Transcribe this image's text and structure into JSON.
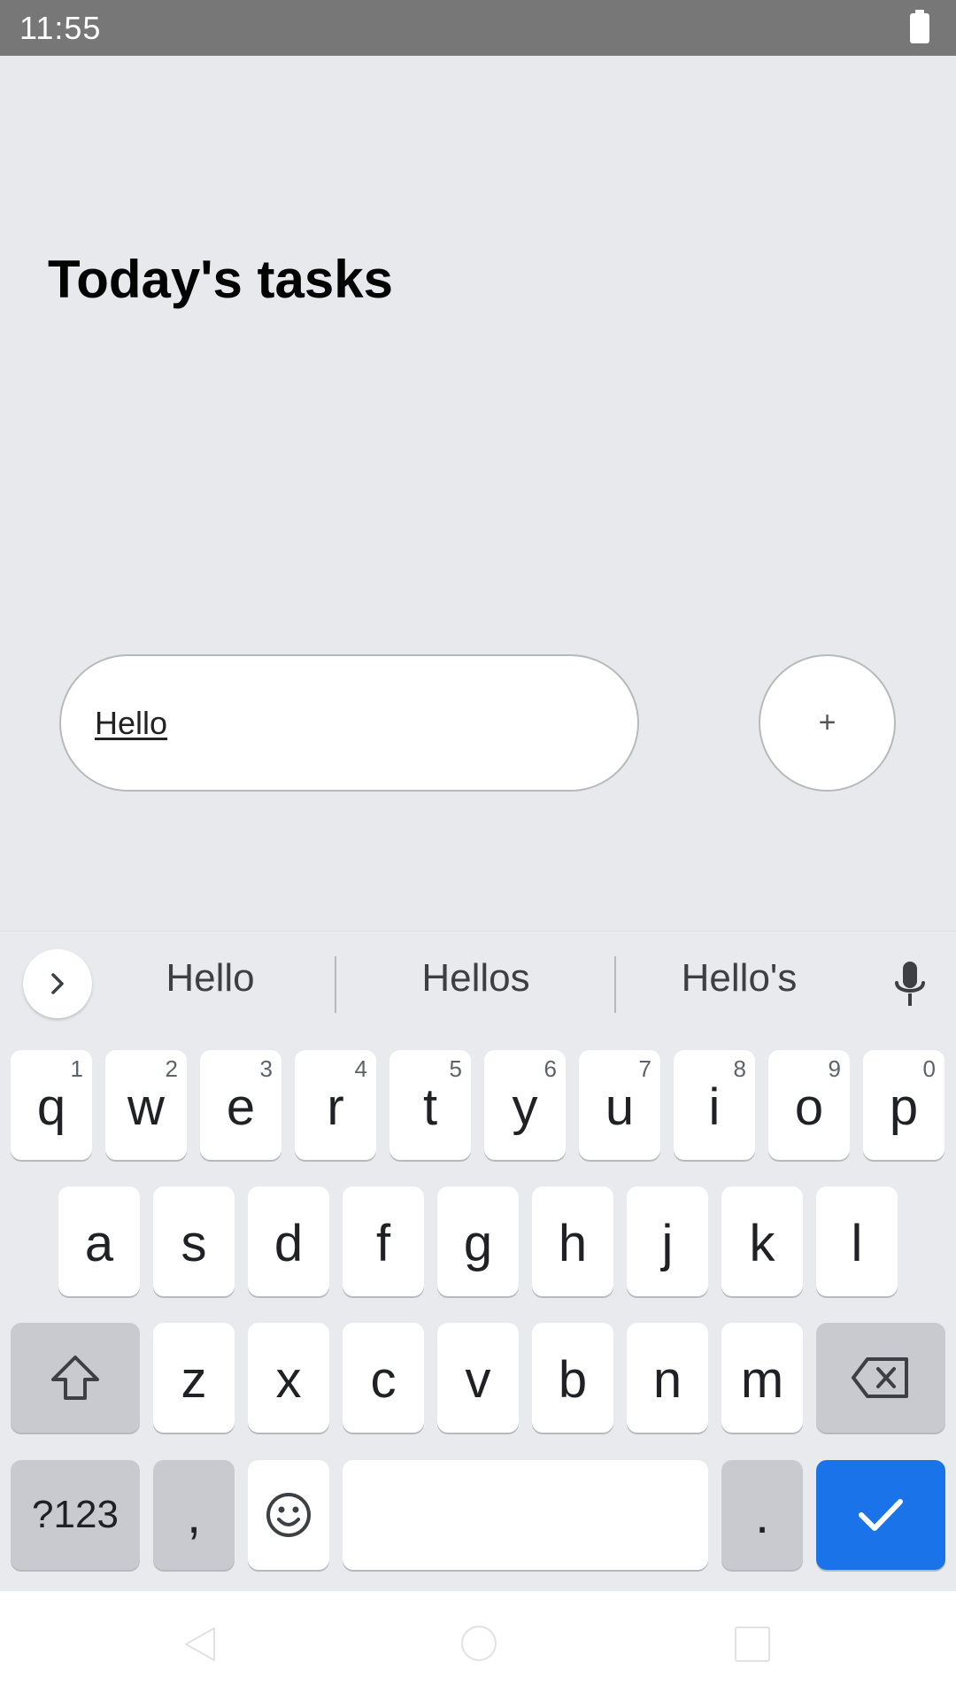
{
  "status_bar": {
    "time": "11:55",
    "battery_icon": "battery-full-icon"
  },
  "app": {
    "title": "Today's tasks",
    "task_input": {
      "value": "Hello"
    },
    "add_button": {
      "label": "+"
    }
  },
  "keyboard": {
    "suggestions": [
      "Hello",
      "Hellos",
      "Hello's"
    ],
    "row1": [
      {
        "key": "q",
        "hint": "1"
      },
      {
        "key": "w",
        "hint": "2"
      },
      {
        "key": "e",
        "hint": "3"
      },
      {
        "key": "r",
        "hint": "4"
      },
      {
        "key": "t",
        "hint": "5"
      },
      {
        "key": "y",
        "hint": "6"
      },
      {
        "key": "u",
        "hint": "7"
      },
      {
        "key": "i",
        "hint": "8"
      },
      {
        "key": "o",
        "hint": "9"
      },
      {
        "key": "p",
        "hint": "0"
      }
    ],
    "row2": [
      "a",
      "s",
      "d",
      "f",
      "g",
      "h",
      "j",
      "k",
      "l"
    ],
    "row3": [
      "z",
      "x",
      "c",
      "v",
      "b",
      "n",
      "m"
    ],
    "symbols_label": "?123",
    "comma_label": ",",
    "period_label": ".",
    "action_color": "#1a73e8"
  },
  "nav_bar": {
    "icons": [
      "back-icon",
      "home-icon",
      "recents-icon"
    ]
  }
}
